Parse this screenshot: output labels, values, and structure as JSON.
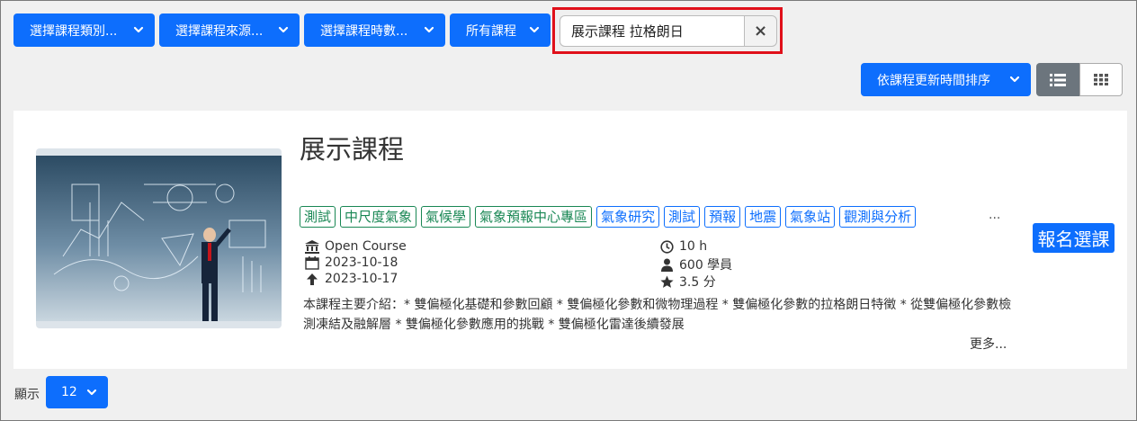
{
  "filters": {
    "category": "選擇課程類別...",
    "source": "選擇課程來源...",
    "hours": "選擇課程時數...",
    "scope": "所有課程"
  },
  "search": {
    "value": "展示課程 拉格朗日",
    "clear_icon": "×"
  },
  "sort": {
    "label": "依課程更新時間排序"
  },
  "course": {
    "title": "展示課程",
    "tags": [
      {
        "label": "測試",
        "color": "green"
      },
      {
        "label": "中尺度氣象",
        "color": "green"
      },
      {
        "label": "氣候學",
        "color": "green"
      },
      {
        "label": "氣象預報中心專區",
        "color": "green"
      },
      {
        "label": "氣象研究",
        "color": "blue"
      },
      {
        "label": "測試",
        "color": "blue"
      },
      {
        "label": "預報",
        "color": "blue"
      },
      {
        "label": "地震",
        "color": "blue"
      },
      {
        "label": "氣象站",
        "color": "blue"
      },
      {
        "label": "觀測與分析",
        "color": "blue"
      }
    ],
    "tags_more": "...",
    "source": "Open Course",
    "start_date": "2023-10-18",
    "updated_date": "2023-10-17",
    "hours": "10 h",
    "students": "600 學員",
    "rating": "3.5 分",
    "description": "本課程主要介紹：* 雙偏極化基礎和參數回顧 * 雙偏極化參數和微物理過程 * 雙偏極化參數的拉格朗日特徵 * 從雙偏極化參數檢測凍結及融解層 * 雙偏極化參數應用的挑戰 * 雙偏極化雷達後續發展",
    "more": "更多...",
    "enroll": "報名選課"
  },
  "paging": {
    "label": "顯示",
    "value": "12"
  },
  "colors": {
    "primary": "#0d6efd",
    "tag_green": "#198754",
    "highlight": "#e0101a"
  }
}
